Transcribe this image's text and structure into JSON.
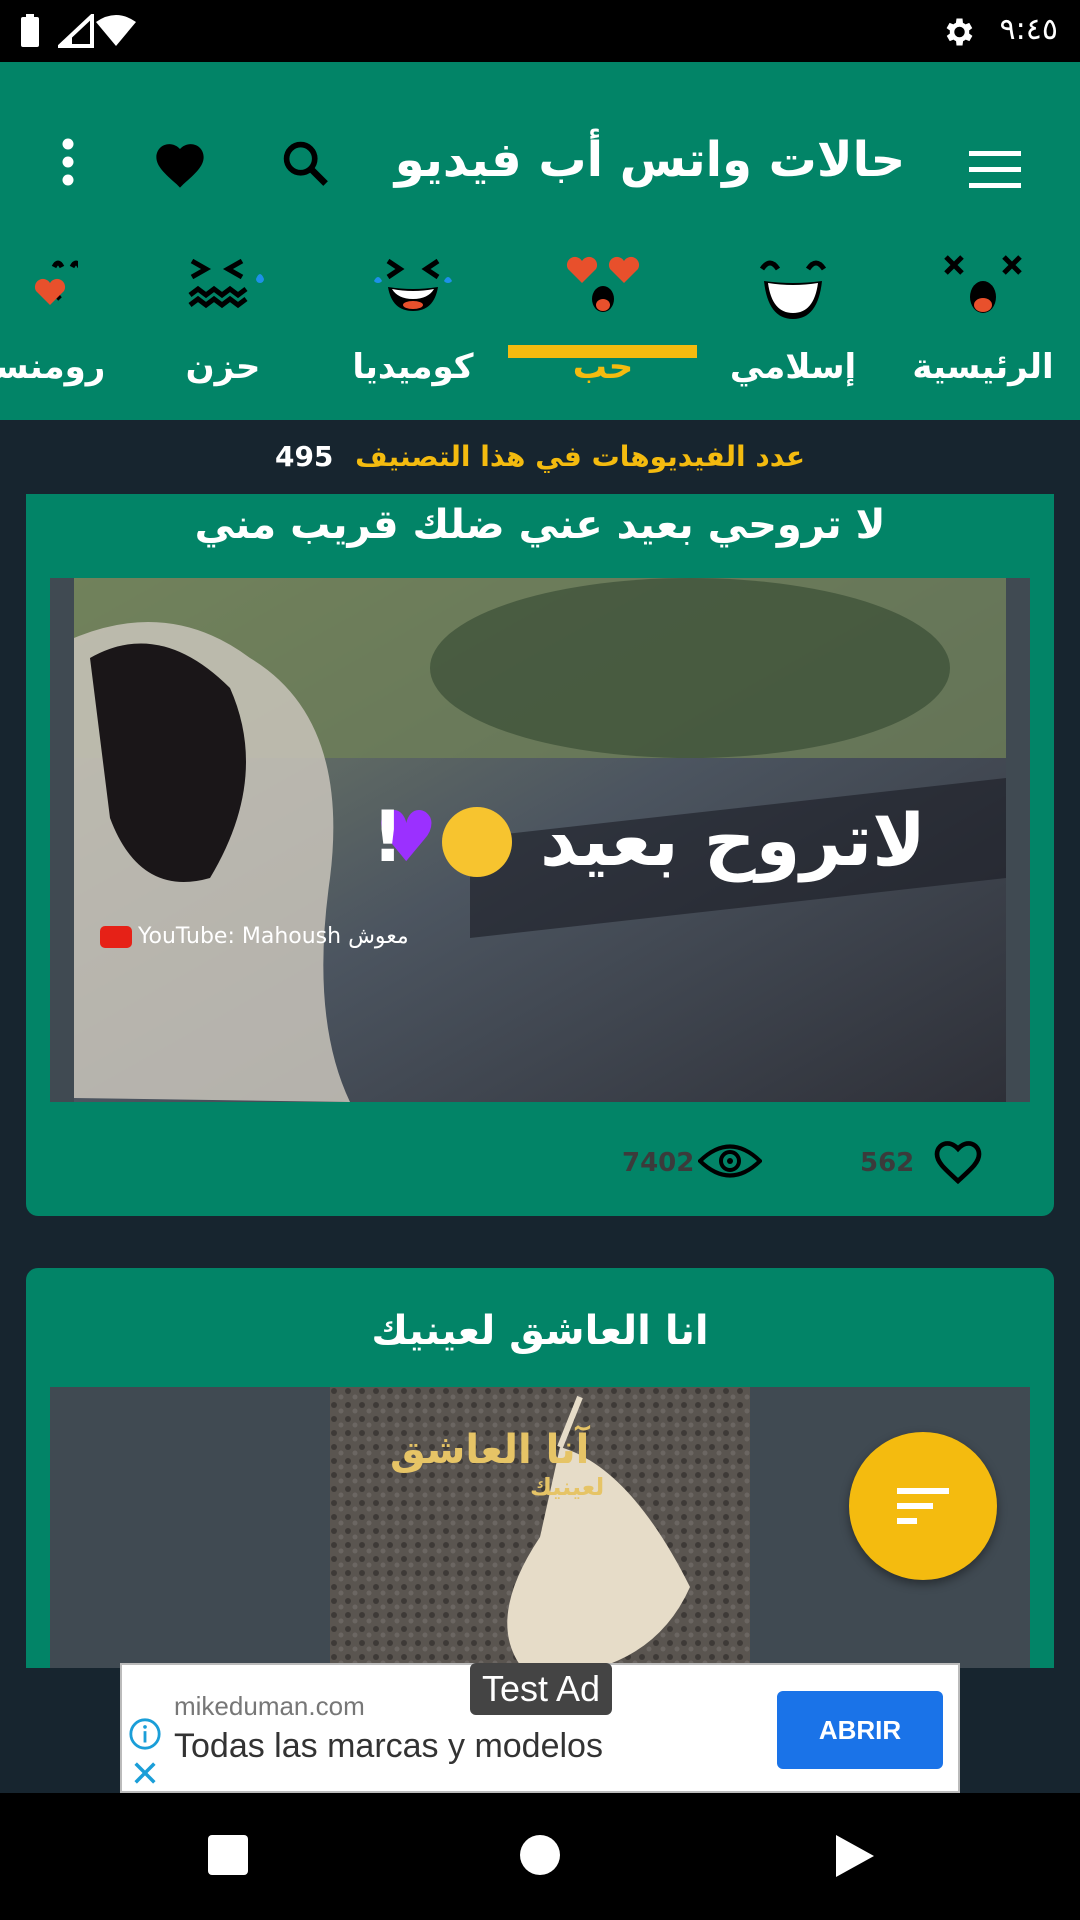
{
  "status_bar": {
    "time": "٩:٤٥"
  },
  "app_bar": {
    "title": "حالات واتس أب فيديو"
  },
  "tabs": [
    {
      "label": "الرئيسية",
      "emoji": "dizzy-face"
    },
    {
      "label": "إسلامي",
      "emoji": "smile-face"
    },
    {
      "label": "حب",
      "emoji": "heart-eyes-face",
      "active": true
    },
    {
      "label": "كوميديا",
      "emoji": "laugh-cry-face"
    },
    {
      "label": "حزن",
      "emoji": "crying-face"
    },
    {
      "label": "رومنسية",
      "emoji": "kiss-face"
    }
  ],
  "category": {
    "count_label": "عدد الفيديوهات في هذا التصنيف",
    "count": "495"
  },
  "videos": [
    {
      "title": "لا تروحي بعيد عني ضلك قريب مني",
      "overlay_text": "لاتروح بعيد",
      "watermark": "YouTube: Mahoush معوش",
      "views": "7402",
      "likes": "562"
    },
    {
      "title": "انا العاشق لعينيك",
      "overlay_text": "آنا العاشق",
      "overlay_sub": "لعينيك"
    }
  ],
  "ad": {
    "badge": "Test Ad",
    "domain": "mikeduman.com",
    "headline": "Todas las marcas y modelos",
    "cta": "ABRIR"
  },
  "colors": {
    "primary": "#028467",
    "accent": "#f4bb0f",
    "background": "#17252f"
  }
}
